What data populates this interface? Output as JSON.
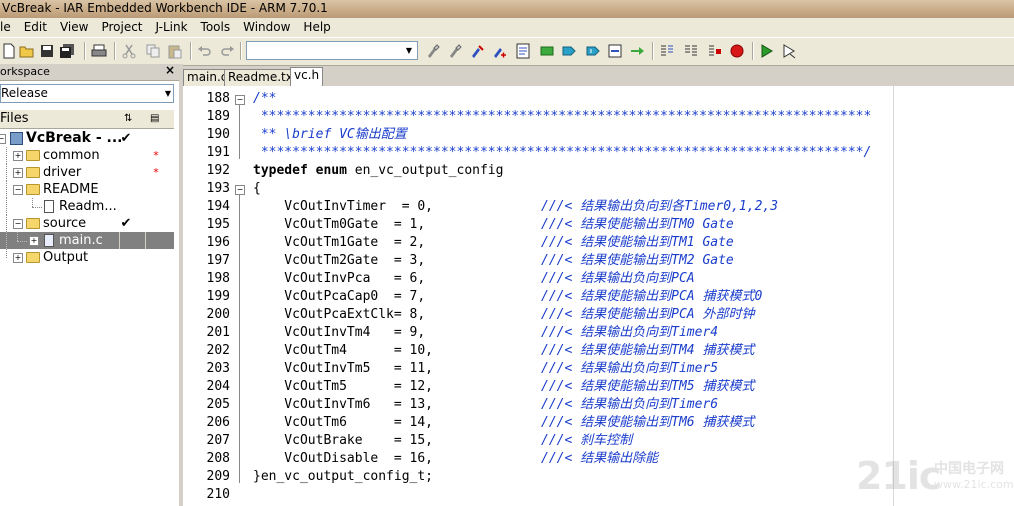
{
  "window": {
    "title": "VcBreak - IAR Embedded Workbench IDE - ARM 7.70.1"
  },
  "menu": [
    "le",
    "Edit",
    "View",
    "Project",
    "J-Link",
    "Tools",
    "Window",
    "Help"
  ],
  "toolbar": {
    "combo_value": "",
    "icons": [
      "new-file-icon",
      "open-file-icon",
      "save-icon",
      "save-all-icon",
      "print-icon",
      "cut-icon",
      "copy-icon",
      "paste-icon",
      "undo-icon",
      "redo-icon",
      "find-icon",
      "find-next-icon",
      "find-prev-icon",
      "replace-icon",
      "goto-icon",
      "bookmark-icon",
      "next-bookmark-icon",
      "prev-bookmark-icon",
      "navigate-icon",
      "compile-icon",
      "make-icon",
      "stop-build-icon",
      "breakpoint-icon",
      "download-debug-icon",
      "debug-without-download-icon"
    ]
  },
  "workspace": {
    "title": "orkspace",
    "close_label": "×",
    "configuration": "Release",
    "files_header": "Files",
    "tree": [
      {
        "label": "VcBreak - ...",
        "mark": "✔",
        "bold": true
      },
      {
        "label": "common",
        "mark": "*"
      },
      {
        "label": "driver",
        "mark": "*"
      },
      {
        "label": "README",
        "mark": ""
      },
      {
        "label": "Readm...",
        "mark": ""
      },
      {
        "label": "source",
        "mark": "✔"
      },
      {
        "label": "main.c",
        "mark": ""
      },
      {
        "label": "Output",
        "mark": ""
      }
    ]
  },
  "tabs": [
    "main.c",
    "Readme.txt",
    "vc.h"
  ],
  "editor": {
    "lines": [
      {
        "n": "188",
        "code": "/**"
      },
      {
        "n": "189",
        "code": " ******************************************************************************"
      },
      {
        "n": "190",
        "code": " ** \\brief VC输出配置"
      },
      {
        "n": "191",
        "code": " *****************************************************************************/"
      },
      {
        "n": "192",
        "code": "typedef enum en_vc_output_config"
      },
      {
        "n": "193",
        "code": "{"
      },
      {
        "n": "194",
        "code": "    VcOutInvTimer  = 0,",
        "comment": "///< 结果输出负向到各Timer0,1,2,3"
      },
      {
        "n": "195",
        "code": "    VcOutTm0Gate  = 1,",
        "comment": "///< 结果使能输出到TM0 Gate"
      },
      {
        "n": "196",
        "code": "    VcOutTm1Gate  = 2,",
        "comment": "///< 结果使能输出到TM1 Gate"
      },
      {
        "n": "197",
        "code": "    VcOutTm2Gate  = 3,",
        "comment": "///< 结果使能输出到TM2 Gate"
      },
      {
        "n": "198",
        "code": "    VcOutInvPca   = 6,",
        "comment": "///< 结果输出负向到PCA"
      },
      {
        "n": "199",
        "code": "    VcOutPcaCap0  = 7,",
        "comment": "///< 结果使能输出到PCA 捕获模式0"
      },
      {
        "n": "200",
        "code": "    VcOutPcaExtClk= 8,",
        "comment": "///< 结果使能输出到PCA 外部时钟"
      },
      {
        "n": "201",
        "code": "    VcOutInvTm4   = 9,",
        "comment": "///< 结果输出负向到Timer4"
      },
      {
        "n": "202",
        "code": "    VcOutTm4      = 10,",
        "comment": "///< 结果使能输出到TM4 捕获模式"
      },
      {
        "n": "203",
        "code": "    VcOutInvTm5   = 11,",
        "comment": "///< 结果输出负向到Timer5"
      },
      {
        "n": "204",
        "code": "    VcOutTm5      = 12,",
        "comment": "///< 结果使能输出到TM5 捕获模式"
      },
      {
        "n": "205",
        "code": "    VcOutInvTm6   = 13,",
        "comment": "///< 结果输出负向到Timer6"
      },
      {
        "n": "206",
        "code": "    VcOutTm6      = 14,",
        "comment": "///< 结果使能输出到TM6 捕获模式"
      },
      {
        "n": "207",
        "code": "    VcOutBrake    = 15,",
        "comment": "///< 刹车控制"
      },
      {
        "n": "208",
        "code": "    VcOutDisable  = 16,",
        "comment": "///< 结果输出除能"
      },
      {
        "n": "209",
        "code": "}en_vc_output_config_t;"
      },
      {
        "n": "210",
        "code": ""
      }
    ]
  },
  "watermark": {
    "logo": "21ic",
    "cn": "中国电子网",
    "url": "www.21ic.com"
  },
  "colors": {
    "comment": "#1a3dcc",
    "title_bar": "#c9ab86",
    "chrome": "#d4d0c8"
  }
}
